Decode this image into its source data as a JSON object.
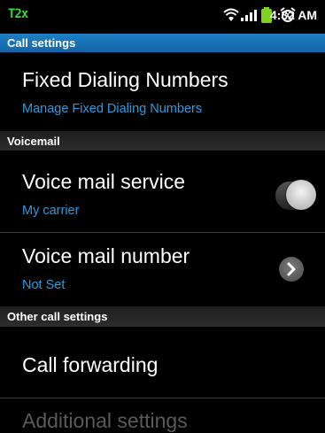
{
  "status_bar": {
    "app_indicator": "T2x",
    "time": "4:32 AM",
    "icons": [
      "wifi-icon",
      "signal-icon",
      "battery-icon",
      "alarm-icon"
    ]
  },
  "sections": {
    "call_settings": "Call settings",
    "voicemail": "Voicemail",
    "other_call_settings": "Other call settings"
  },
  "items": {
    "fdn": {
      "title": "Fixed Dialing Numbers",
      "subtitle": "Manage Fixed Dialing Numbers"
    },
    "voice_mail_service": {
      "title": "Voice mail service",
      "subtitle": "My carrier"
    },
    "voice_mail_number": {
      "title": "Voice mail number",
      "subtitle": "Not Set"
    },
    "call_forwarding": {
      "title": "Call forwarding"
    },
    "additional_settings": {
      "title": "Additional settings"
    }
  },
  "colors": {
    "accent_blue": "#2e9be0",
    "header_blue": "#1d7fc4",
    "status_green": "#3bd33b"
  }
}
